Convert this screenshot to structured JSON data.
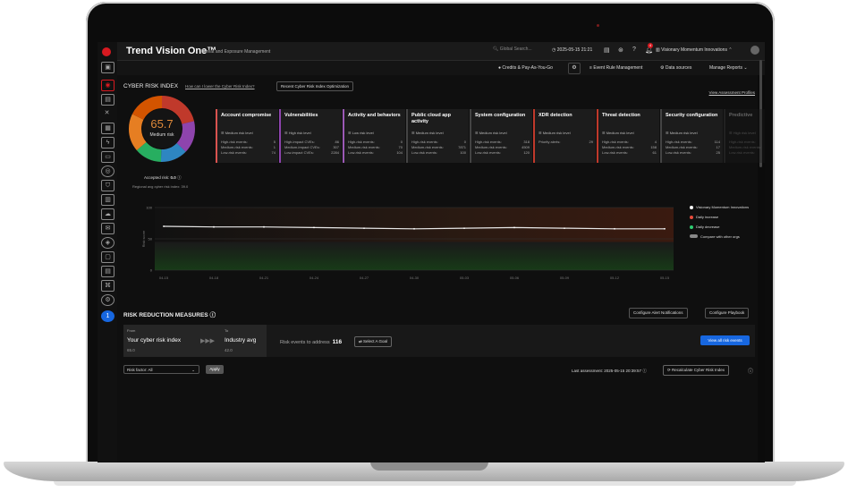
{
  "app": {
    "title": "Trend Vision One™",
    "subtitle": "Threat and Exposure Management",
    "search_placeholder": "Global Search...",
    "datetime": "2025-05-15 21:21",
    "notification_count": "4",
    "org_name": "Visionary Momentum Innovations"
  },
  "subbar": {
    "credits": "Credits & Pay-As-You-Go",
    "event_rule": "Event Rule Management",
    "data_sources": "Data sources",
    "manage_reports": "Manage Reports"
  },
  "cri": {
    "title": "CYBER RISK INDEX",
    "help_link": "How can I lower the Cyber Risk Index?",
    "optimization_button": "Recent Cyber Risk Index Optimization",
    "view_profiles": "View Assessment Profiles",
    "score": "65.7",
    "risk_level": "Medium risk",
    "accepted_risk_label": "Accepted risk:",
    "accepted_risk_value": "0.0",
    "regional_avg": "Regional avg cyber risk index: 39.0"
  },
  "cards": [
    {
      "title": "Account compromise",
      "level": "Medium risk level",
      "color": "#d9534f",
      "rows": [
        [
          "High-risk events:",
          "5"
        ],
        [
          "Medium-risk events:",
          "1"
        ],
        [
          "Low-risk events:",
          "74"
        ]
      ]
    },
    {
      "title": "Vulnerabilities",
      "level": "High risk level",
      "color": "#8e44ad",
      "rows": [
        [
          "High-impact CVEs:",
          "86"
        ],
        [
          "Medium-impact CVEs:",
          "307"
        ],
        [
          "Low-impact CVEs:",
          "2284"
        ]
      ]
    },
    {
      "title": "Activity and behaviors",
      "level": "Low risk level",
      "color": "#9b59b6",
      "rows": [
        [
          "High-risk events:",
          "0"
        ],
        [
          "Medium-risk events:",
          "70"
        ],
        [
          "Low-risk events:",
          "104"
        ]
      ]
    },
    {
      "title": "Public cloud app activity",
      "level": "Medium risk level",
      "color": "#444444",
      "rows": [
        [
          "High-risk events:",
          "0"
        ],
        [
          "Medium-risk events:",
          "7871"
        ],
        [
          "Low-risk events:",
          "100"
        ]
      ]
    },
    {
      "title": "System configuration",
      "level": "Medium risk level",
      "color": "#444444",
      "rows": [
        [
          "High-risk events:",
          "318"
        ],
        [
          "Medium-risk events:",
          "4509"
        ],
        [
          "Low-risk events:",
          "120"
        ]
      ]
    },
    {
      "title": "XDR detection",
      "level": "Medium risk level",
      "color": "#c0392b",
      "rows": [
        [
          "Priority alerts:",
          "29"
        ]
      ]
    },
    {
      "title": "Threat detection",
      "level": "Medium risk level",
      "color": "#c0392b",
      "rows": [
        [
          "High-risk events:",
          "4"
        ],
        [
          "Medium-risk events:",
          "158"
        ],
        [
          "Low-risk events:",
          "61"
        ]
      ]
    },
    {
      "title": "Security configuration",
      "level": "Medium risk level",
      "color": "#444444",
      "rows": [
        [
          "High-risk events:",
          "114"
        ],
        [
          "Medium-risk events:",
          "17"
        ],
        [
          "Low-risk events:",
          "25"
        ]
      ]
    },
    {
      "title": "Predictive",
      "level": "High risk level",
      "color": "#444444",
      "rows": [
        [
          "High-risk events:",
          ""
        ],
        [
          "Medium-risk events:",
          ""
        ],
        [
          "Low-risk events:",
          ""
        ]
      ]
    }
  ],
  "chart_data": {
    "type": "line",
    "ylabel": "Risk score",
    "ylim": [
      0,
      100
    ],
    "y_ticks": [
      "100",
      "50",
      "0"
    ],
    "x": [
      "04-15",
      "04-18",
      "04-21",
      "04-24",
      "04-27",
      "04-30",
      "05-03",
      "05-06",
      "05-09",
      "05-12",
      "05-15"
    ],
    "series": [
      {
        "name": "Visionary Momentum Innovations",
        "values": [
          70,
          69,
          69,
          68,
          67,
          66,
          67,
          68,
          67,
          66,
          66
        ]
      }
    ]
  },
  "legend": {
    "org": "Visionary Momentum Innovations",
    "increase": "Daily increase",
    "decrease": "Daily decrease",
    "compare": "Compare with other orgs"
  },
  "rrm": {
    "title": "RISK REDUCTION MEASURES",
    "alert_button": "Configure Alert Notifications",
    "playbook_button": "Configure Playbook",
    "from_label": "From",
    "from_main": "Your cyber risk index",
    "from_value": "65.0",
    "to_label": "To",
    "to_main": "Industry avg",
    "to_value": "42.0",
    "risk_events_label": "Risk events to address",
    "risk_events_value": "116",
    "goal_button": "Select A Goal",
    "view_all_button": "View all risk events"
  },
  "footer": {
    "filter_value": "Risk factor: All",
    "apply_button": "Apply",
    "last_assessment": "Last assessment: 2025-05-15 20:39:57",
    "recalc_button": "Recalculate Cyber Risk Index"
  }
}
